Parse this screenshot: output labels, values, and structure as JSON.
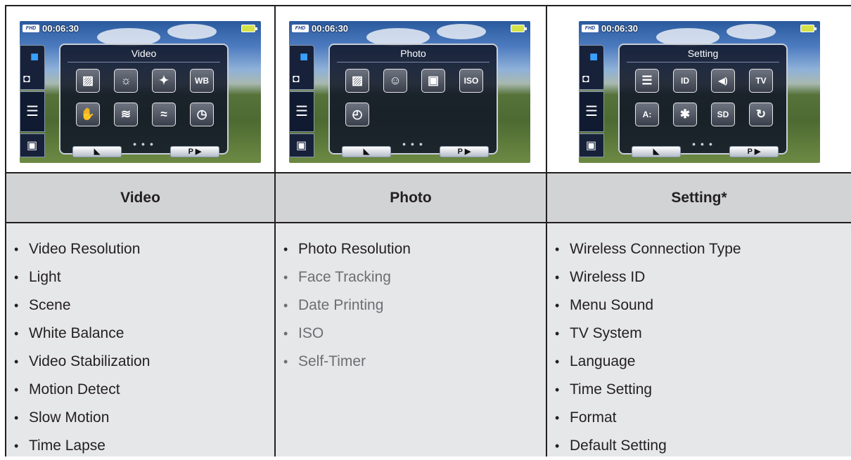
{
  "osd": {
    "format_badge": "FHD",
    "timecode": "00:06:30"
  },
  "columns": [
    {
      "screen": {
        "title": "Video",
        "icons": [
          "resolution-icon",
          "light-icon",
          "scene-icon",
          "wb-icon",
          "stabilization-icon",
          "motion-detect-icon",
          "slow-motion-icon",
          "time-lapse-icon"
        ],
        "icon_glyphs": [
          "▨",
          "☼",
          "✦",
          "WB",
          "✋",
          "≋",
          "≈",
          "◷"
        ],
        "back_label": "◣",
        "next_label": "P ▶"
      },
      "header": "Video",
      "items": [
        {
          "label": "Video Resolution",
          "dim": false
        },
        {
          "label": "Light",
          "dim": false
        },
        {
          "label": "Scene",
          "dim": false
        },
        {
          "label": "White Balance",
          "dim": false
        },
        {
          "label": "Video Stabilization",
          "dim": false
        },
        {
          "label": "Motion Detect",
          "dim": false
        },
        {
          "label": "Slow Motion",
          "dim": false
        },
        {
          "label": "Time Lapse",
          "dim": false
        }
      ]
    },
    {
      "screen": {
        "title": "Photo",
        "icons": [
          "resolution-icon",
          "face-tracking-icon",
          "date-printing-icon",
          "iso-icon",
          "self-timer-icon"
        ],
        "icon_glyphs": [
          "▨",
          "☺",
          "▣",
          "ISO",
          "◴"
        ],
        "back_label": "◣",
        "next_label": "P ▶"
      },
      "header": "Photo",
      "items": [
        {
          "label": "Photo Resolution",
          "dim": false
        },
        {
          "label": "Face Tracking",
          "dim": true
        },
        {
          "label": "Date Printing",
          "dim": true
        },
        {
          "label": "ISO",
          "dim": true
        },
        {
          "label": "Self-Timer",
          "dim": true
        }
      ]
    },
    {
      "screen": {
        "title": "Setting",
        "icons": [
          "wifi-icon",
          "wireless-id-icon",
          "sound-icon",
          "tv-icon",
          "language-icon",
          "time-setting-icon",
          "format-sd-icon",
          "default-reset-icon"
        ],
        "icon_glyphs": [
          "☰",
          "ID",
          "◀)",
          "TV",
          "A:",
          "✱",
          "SD",
          "↻"
        ],
        "back_label": "◣",
        "next_label": "P ▶"
      },
      "header": "Setting*",
      "items": [
        {
          "label": "Wireless Connection Type",
          "dim": false
        },
        {
          "label": "Wireless ID",
          "dim": false
        },
        {
          "label": "Menu Sound",
          "dim": false
        },
        {
          "label": "TV System",
          "dim": false
        },
        {
          "label": "Language",
          "dim": false
        },
        {
          "label": "Time Setting",
          "dim": false
        },
        {
          "label": "Format",
          "dim": false
        },
        {
          "label": "Default Setting",
          "dim": false
        }
      ]
    }
  ]
}
